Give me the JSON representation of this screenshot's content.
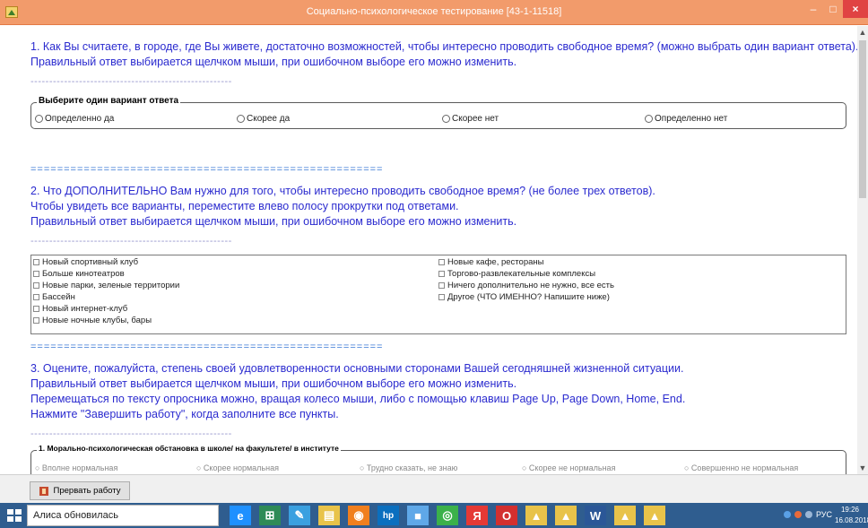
{
  "window": {
    "title": "Социально-психологическое тестирование [43-1-11518]",
    "minimize": "–",
    "maximize": "□",
    "close": "×"
  },
  "q1": {
    "lines": [
      "1. Как Вы считаете, в городе, где Вы живете, достаточно возможностей, чтобы интересно проводить свободное время? (можно выбрать один вариант ответа).",
      "Правильный ответ выбирается щелчком мыши, при ошибочном выборе его можно изменить."
    ],
    "dash": "------------------------------------------------------",
    "group_label": "Выберите один вариант ответа",
    "options": [
      "Определенно да",
      "Скорее да",
      "Скорее нет",
      "Определенно нет"
    ]
  },
  "separator": "=====================================================",
  "q2": {
    "lines": [
      "2. Что ДОПОЛНИТЕЛЬНО Вам нужно для того, чтобы интересно проводить свободное время? (не более трех ответов).",
      "Чтобы увидеть все варианты, переместите влево полосу прокрутки под ответами.",
      "Правильный ответ выбирается щелчком мыши, при ошибочном выборе его можно изменить."
    ],
    "dash": "------------------------------------------------------",
    "col1": [
      "Новый спортивный клуб",
      "Больше кинотеатров",
      "Новые парки, зеленые территории",
      "Бассейн",
      "Новый интернет-клуб",
      "Новые ночные клубы, бары"
    ],
    "col2": [
      "Новые кафе, рестораны",
      "Торгово-развлекательные комплексы",
      "Ничего дополнительно не нужно, все есть",
      "Другое (ЧТО ИМЕННО? Напишите ниже)"
    ]
  },
  "q3": {
    "lines": [
      "3. Оцените, пожалуйста, степень своей удовлетворенности основными сторонами Вашей сегодняшней жизненной ситуации.",
      "Правильный ответ выбирается щелчком мыши, при ошибочном выборе его можно изменить.",
      "Перемещаться по тексту опросника можно, вращая колесо мыши, либо с помощью клавиш Page Up, Page Down, Home, End.",
      "Нажмите \"Завершить работу\", когда заполните все пункты."
    ],
    "dash": "------------------------------------------------------",
    "group_label": "1. Морально-психологическая обстановка в школе/ на факультете/ в институте",
    "faded_options": [
      "○ Вполне нормальная",
      "○ Скорее нормальная",
      "○ Трудно сказать, не знаю",
      "○ Скорее не нормальная",
      "○ Совершенно не нормальная"
    ]
  },
  "bottom": {
    "abort_label": "Прервать работу"
  },
  "taskbar": {
    "search_text": "Алиса обновилась",
    "lang": "РУС",
    "time": "19:26",
    "date": "16.08.2018",
    "icons": [
      {
        "name": "edge-icon",
        "glyph": "e",
        "color": "#1e90ff"
      },
      {
        "name": "store-icon",
        "glyph": "⊞",
        "color": "#2e8b57"
      },
      {
        "name": "pen-icon",
        "glyph": "✎",
        "color": "#3aa0e0"
      },
      {
        "name": "explorer-icon",
        "glyph": "▤",
        "color": "#e8c34a"
      },
      {
        "name": "firefox-icon",
        "glyph": "◉",
        "color": "#f07f1e"
      },
      {
        "name": "hp-icon",
        "glyph": "hp",
        "color": "#0a6fbf"
      },
      {
        "name": "screen-icon",
        "glyph": "■",
        "color": "#5fa8e8"
      },
      {
        "name": "chrome-icon",
        "glyph": "◎",
        "color": "#3bb14a"
      },
      {
        "name": "yandex-icon",
        "glyph": "Я",
        "color": "#e53935"
      },
      {
        "name": "opera-icon",
        "glyph": "O",
        "color": "#d32f2f"
      },
      {
        "name": "app-test-icon-1",
        "glyph": "▲",
        "color": "#e8c34a"
      },
      {
        "name": "app-test-icon-2",
        "glyph": "▲",
        "color": "#e8c34a"
      },
      {
        "name": "word-icon",
        "glyph": "W",
        "color": "#2b5797"
      },
      {
        "name": "app-test-icon-3",
        "glyph": "▲",
        "color": "#e8c34a"
      },
      {
        "name": "app-test-icon-4",
        "glyph": "▲",
        "color": "#e8c34a"
      }
    ]
  }
}
